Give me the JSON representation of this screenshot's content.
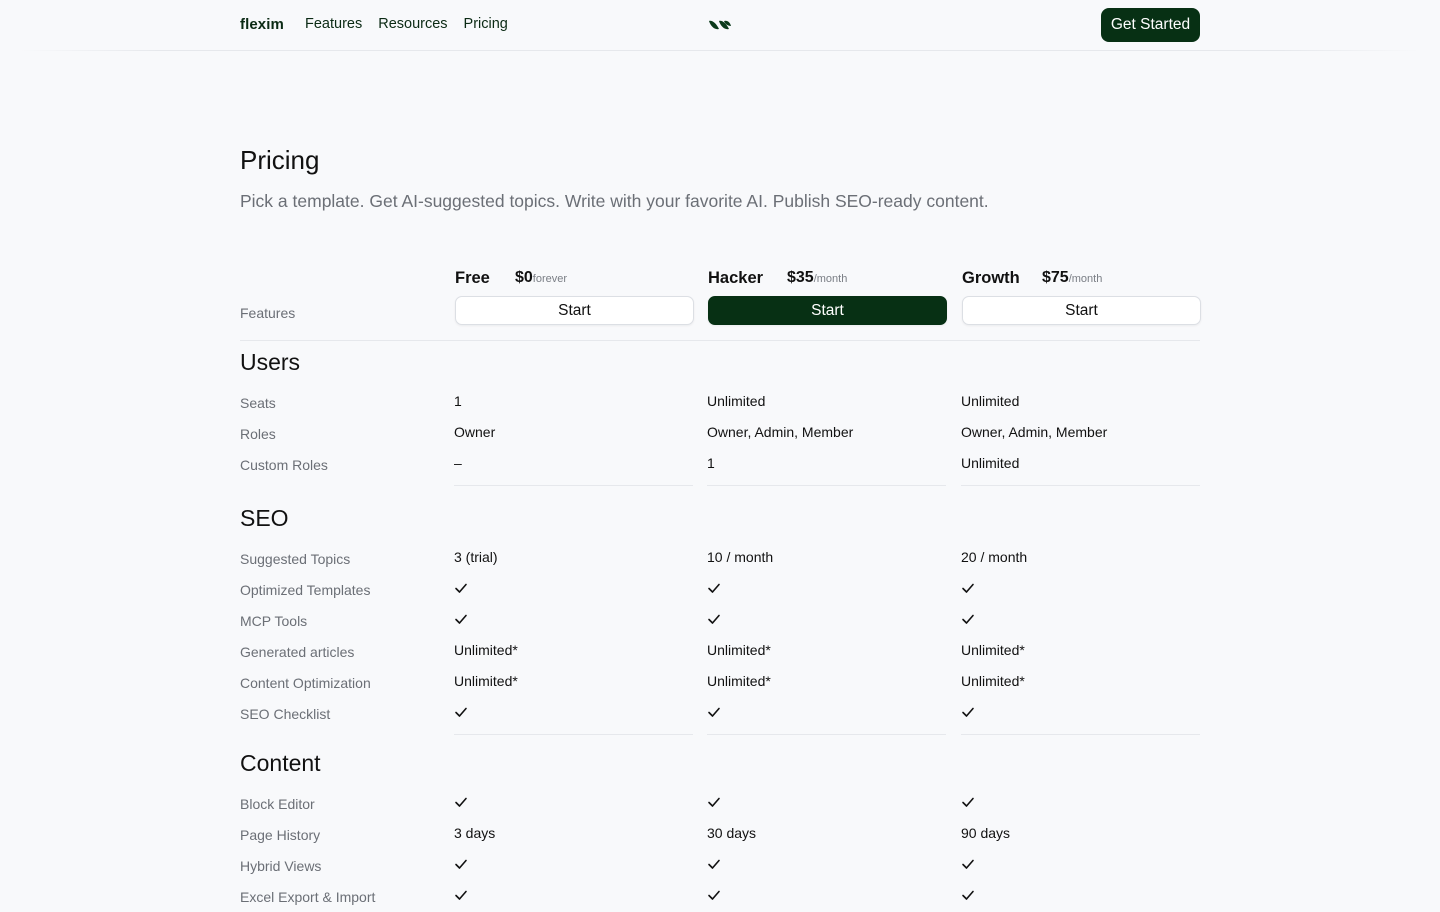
{
  "nav": {
    "brand": "flexim",
    "links": [
      "Features",
      "Resources",
      "Pricing"
    ],
    "logo_icon": "double-leaf-logo-icon",
    "cta": "Get Started"
  },
  "hero": {
    "title": "Pricing",
    "subtitle": "Pick a template. Get AI-suggested topics. Write with your favorite AI. Publish SEO-ready content."
  },
  "features_label": "Features",
  "plans": [
    {
      "name": "Free",
      "price": "$0",
      "period": "forever",
      "button": "Start",
      "primary": false
    },
    {
      "name": "Hacker",
      "price": "$35",
      "period": "/month",
      "button": "Start",
      "primary": true
    },
    {
      "name": "Growth",
      "price": "$75",
      "period": "/month",
      "button": "Start",
      "primary": false
    }
  ],
  "sections": [
    {
      "title": "Users",
      "rows": [
        {
          "label": "Seats",
          "values": [
            "1",
            "Unlimited",
            "Unlimited"
          ]
        },
        {
          "label": "Roles",
          "values": [
            "Owner",
            "Owner, Admin, Member",
            "Owner, Admin, Member"
          ]
        },
        {
          "label": "Custom Roles",
          "values": [
            "–",
            "1",
            "Unlimited"
          ]
        }
      ]
    },
    {
      "title": "SEO",
      "rows": [
        {
          "label": "Suggested Topics",
          "values": [
            "3 (trial)",
            "10 / month",
            "20 / month"
          ]
        },
        {
          "label": "Optimized Templates",
          "values": [
            "check",
            "check",
            "check"
          ]
        },
        {
          "label": "MCP Tools",
          "values": [
            "check",
            "check",
            "check"
          ]
        },
        {
          "label": "Generated articles",
          "values": [
            "Unlimited*",
            "Unlimited*",
            "Unlimited*"
          ]
        },
        {
          "label": "Content Optimization",
          "values": [
            "Unlimited*",
            "Unlimited*",
            "Unlimited*"
          ]
        },
        {
          "label": "SEO Checklist",
          "values": [
            "check",
            "check",
            "check"
          ]
        }
      ]
    },
    {
      "title": "Content",
      "rows": [
        {
          "label": "Block Editor",
          "values": [
            "check",
            "check",
            "check"
          ]
        },
        {
          "label": "Page History",
          "values": [
            "3 days",
            "30 days",
            "90 days"
          ]
        },
        {
          "label": "Hybrid Views",
          "values": [
            "check",
            "check",
            "check"
          ]
        },
        {
          "label": "Excel Export & Import",
          "values": [
            "check",
            "check",
            "check"
          ]
        }
      ]
    }
  ],
  "colors": {
    "accent": "#073014",
    "text_muted": "#6b6f76",
    "background": "#f8f9fb",
    "rule": "#e6e8ec"
  }
}
